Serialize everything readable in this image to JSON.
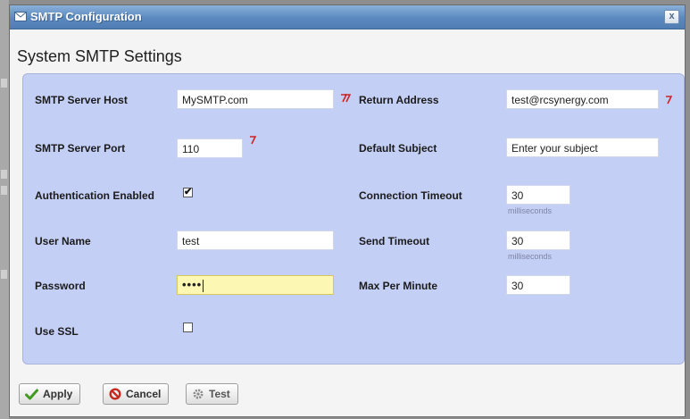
{
  "dialog": {
    "title": "SMTP Configuration",
    "close_symbol": "x"
  },
  "heading": "System SMTP Settings",
  "left_fields": {
    "host": {
      "label": "SMTP Server Host",
      "value": "MySMTP.com",
      "required": true
    },
    "port": {
      "label": "SMTP Server Port",
      "value": "110",
      "required": true
    },
    "auth": {
      "label": "Authentication Enabled",
      "checked": true,
      "mark": "✔"
    },
    "user": {
      "label": "User Name",
      "value": "test"
    },
    "password": {
      "label": "Password",
      "value": "••••"
    },
    "ssl": {
      "label": "Use SSL",
      "checked": false,
      "mark": ""
    }
  },
  "right_fields": {
    "return_address": {
      "label": "Return Address",
      "value": "test@rcsynergy.com",
      "required": true
    },
    "subject": {
      "label": "Default Subject",
      "value": "Enter your subject"
    },
    "conn_timeout": {
      "label": "Connection Timeout",
      "value": "30",
      "unit": "milliseconds"
    },
    "send_timeout": {
      "label": "Send Timeout",
      "value": "30",
      "unit": "milliseconds"
    },
    "max_per_minute": {
      "label": "Max Per Minute",
      "value": "30"
    }
  },
  "buttons": {
    "apply": "Apply",
    "cancel": "Cancel",
    "test": "Test"
  },
  "colors": {
    "titlebar": "#5a88bf",
    "panel": "#c4cff6",
    "required_marker": "#cc2222",
    "focused_field": "#fdf7b4"
  }
}
